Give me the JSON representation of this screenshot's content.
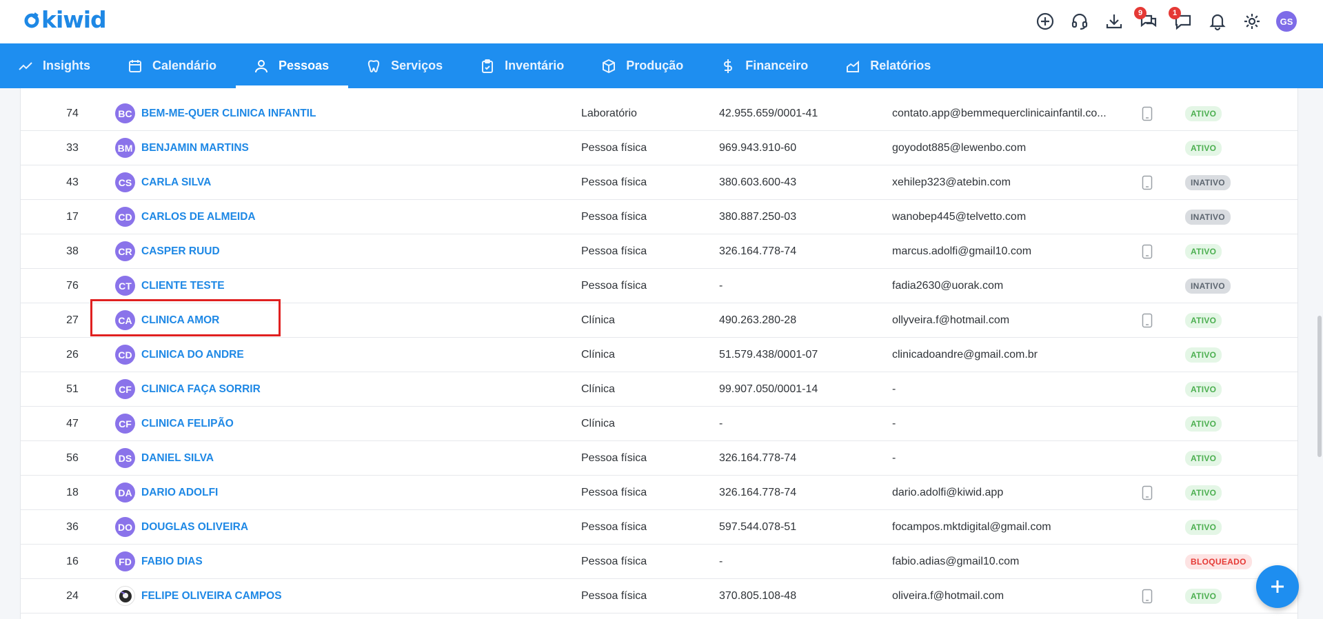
{
  "app": {
    "logo_text": "kiwid"
  },
  "topbar": {
    "icons": [
      {
        "name": "add-circle-icon",
        "badge": ""
      },
      {
        "name": "support-headset-icon",
        "badge": ""
      },
      {
        "name": "download-icon",
        "badge": ""
      },
      {
        "name": "chat-bubbles-icon",
        "badge": "9"
      },
      {
        "name": "message-icon",
        "badge": "1"
      },
      {
        "name": "bell-icon",
        "badge": ""
      },
      {
        "name": "gear-icon",
        "badge": ""
      }
    ],
    "user_initials": "GS"
  },
  "nav": {
    "items": [
      {
        "label": "Insights",
        "icon": "trend-icon"
      },
      {
        "label": "Calendário",
        "icon": "calendar-icon"
      },
      {
        "label": "Pessoas",
        "icon": "person-icon",
        "active": true
      },
      {
        "label": "Serviços",
        "icon": "tooth-icon"
      },
      {
        "label": "Inventário",
        "icon": "clipboard-icon"
      },
      {
        "label": "Produção",
        "icon": "box-icon"
      },
      {
        "label": "Financeiro",
        "icon": "dollar-icon"
      },
      {
        "label": "Relatórios",
        "icon": "chart-area-icon"
      }
    ]
  },
  "table": {
    "rows": [
      {
        "id": "74",
        "initials": "BC",
        "name": "BEM-ME-QUER CLINICA INFANTIL",
        "type": "Laboratório",
        "doc": "42.955.659/0001-41",
        "email": "contato.app@bemmequerclinicainfantil.co...",
        "phone": true,
        "status": "ATIVO"
      },
      {
        "id": "33",
        "initials": "BM",
        "name": "BENJAMIN MARTINS",
        "type": "Pessoa física",
        "doc": "969.943.910-60",
        "email": "goyodot885@lewenbo.com",
        "phone": false,
        "status": "ATIVO"
      },
      {
        "id": "43",
        "initials": "CS",
        "name": "CARLA SILVA",
        "type": "Pessoa física",
        "doc": "380.603.600-43",
        "email": "xehilep323@atebin.com",
        "phone": true,
        "status": "INATIVO"
      },
      {
        "id": "17",
        "initials": "CD",
        "name": "CARLOS DE ALMEIDA",
        "type": "Pessoa física",
        "doc": "380.887.250-03",
        "email": "wanobep445@telvetto.com",
        "phone": false,
        "status": "INATIVO"
      },
      {
        "id": "38",
        "initials": "CR",
        "name": "CASPER RUUD",
        "type": "Pessoa física",
        "doc": "326.164.778-74",
        "email": "marcus.adolfi@gmail10.com",
        "phone": true,
        "status": "ATIVO"
      },
      {
        "id": "76",
        "initials": "CT",
        "name": "CLIENTE TESTE",
        "type": "Pessoa física",
        "doc": "-",
        "email": "fadia2630@uorak.com",
        "phone": false,
        "status": "INATIVO"
      },
      {
        "id": "27",
        "initials": "CA",
        "name": "CLINICA AMOR",
        "type": "Clínica",
        "doc": "490.263.280-28",
        "email": "ollyveira.f@hotmail.com",
        "phone": true,
        "status": "ATIVO"
      },
      {
        "id": "26",
        "initials": "CD",
        "name": "CLINICA DO ANDRE",
        "type": "Clínica",
        "doc": "51.579.438/0001-07",
        "email": "clinicadoandre@gmail.com.br",
        "phone": false,
        "status": "ATIVO"
      },
      {
        "id": "51",
        "initials": "CF",
        "name": "CLINICA FAÇA SORRIR",
        "type": "Clínica",
        "doc": "99.907.050/0001-14",
        "email": "-",
        "phone": false,
        "status": "ATIVO"
      },
      {
        "id": "47",
        "initials": "CF",
        "name": "CLINICA FELIPÃO",
        "type": "Clínica",
        "doc": "-",
        "email": "-",
        "phone": false,
        "status": "ATIVO"
      },
      {
        "id": "56",
        "initials": "DS",
        "name": "DANIEL SILVA",
        "type": "Pessoa física",
        "doc": "326.164.778-74",
        "email": "-",
        "phone": false,
        "status": "ATIVO"
      },
      {
        "id": "18",
        "initials": "DA",
        "name": "DARIO ADOLFI",
        "type": "Pessoa física",
        "doc": "326.164.778-74",
        "email": "dario.adolfi@kiwid.app",
        "phone": true,
        "status": "ATIVO"
      },
      {
        "id": "36",
        "initials": "DO",
        "name": "DOUGLAS OLIVEIRA",
        "type": "Pessoa física",
        "doc": "597.544.078-51",
        "email": "focampos.mktdigital@gmail.com",
        "phone": false,
        "status": "ATIVO"
      },
      {
        "id": "16",
        "initials": "FD",
        "name": "FABIO DIAS",
        "type": "Pessoa física",
        "doc": "-",
        "email": "fabio.adias@gmail10.com",
        "phone": false,
        "status": "BLOQUEADO"
      },
      {
        "id": "24",
        "initials": "",
        "name": "FELIPE OLIVEIRA CAMPOS",
        "type": "Pessoa física",
        "doc": "370.805.108-48",
        "email": "oliveira.f@hotmail.com",
        "phone": true,
        "status": "ATIVO",
        "photo": true
      }
    ]
  },
  "colors": {
    "brand": "#1e8ef0",
    "link": "#1e88e5",
    "avatar": "#8a73ea",
    "highlight": "#e02020"
  }
}
